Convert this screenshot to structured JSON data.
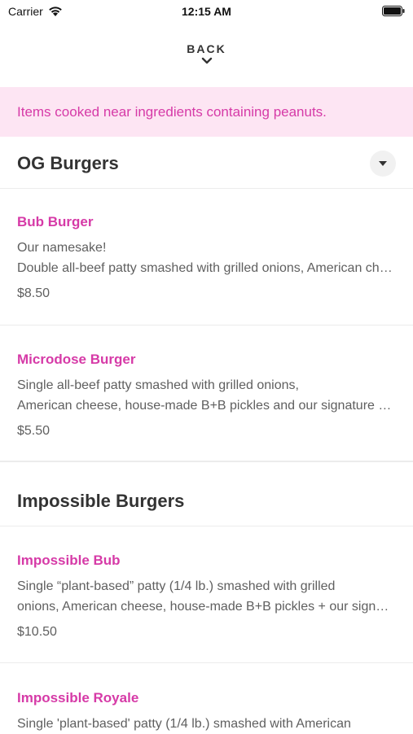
{
  "status_bar": {
    "carrier": "Carrier",
    "time": "12:15 AM"
  },
  "nav": {
    "back_label": "BACK"
  },
  "allergy_notice": "Items cooked near ingredients containing peanuts.",
  "sections": [
    {
      "title": "OG Burgers",
      "items": [
        {
          "name": "Bub Burger",
          "desc_lines": [
            "Our namesake!",
            "Double all-beef patty smashed with grilled onions, American cheese, house-made B+B pickles and our signature sauce"
          ],
          "price": "$8.50"
        },
        {
          "name": "Microdose Burger",
          "desc_lines": [
            "Single all-beef patty smashed with grilled onions,",
            "American cheese, house-made B+B pickles and our signature sauce"
          ],
          "price": "$5.50"
        }
      ]
    },
    {
      "title": "Impossible Burgers",
      "items": [
        {
          "name": "Impossible Bub",
          "desc_lines": [
            "Single “plant-based” patty (1/4 lb.) smashed with grilled",
            "onions, American cheese, house-made B+B pickles + our signature sauce"
          ],
          "price": "$10.50"
        },
        {
          "name": "Impossible Royale",
          "desc_lines": [
            "Single 'plant-based' patty (1/4 lb.) smashed with American"
          ],
          "price": ""
        }
      ]
    }
  ],
  "colors": {
    "accent": "#d63aa7",
    "banner_bg": "#fde5f3"
  }
}
